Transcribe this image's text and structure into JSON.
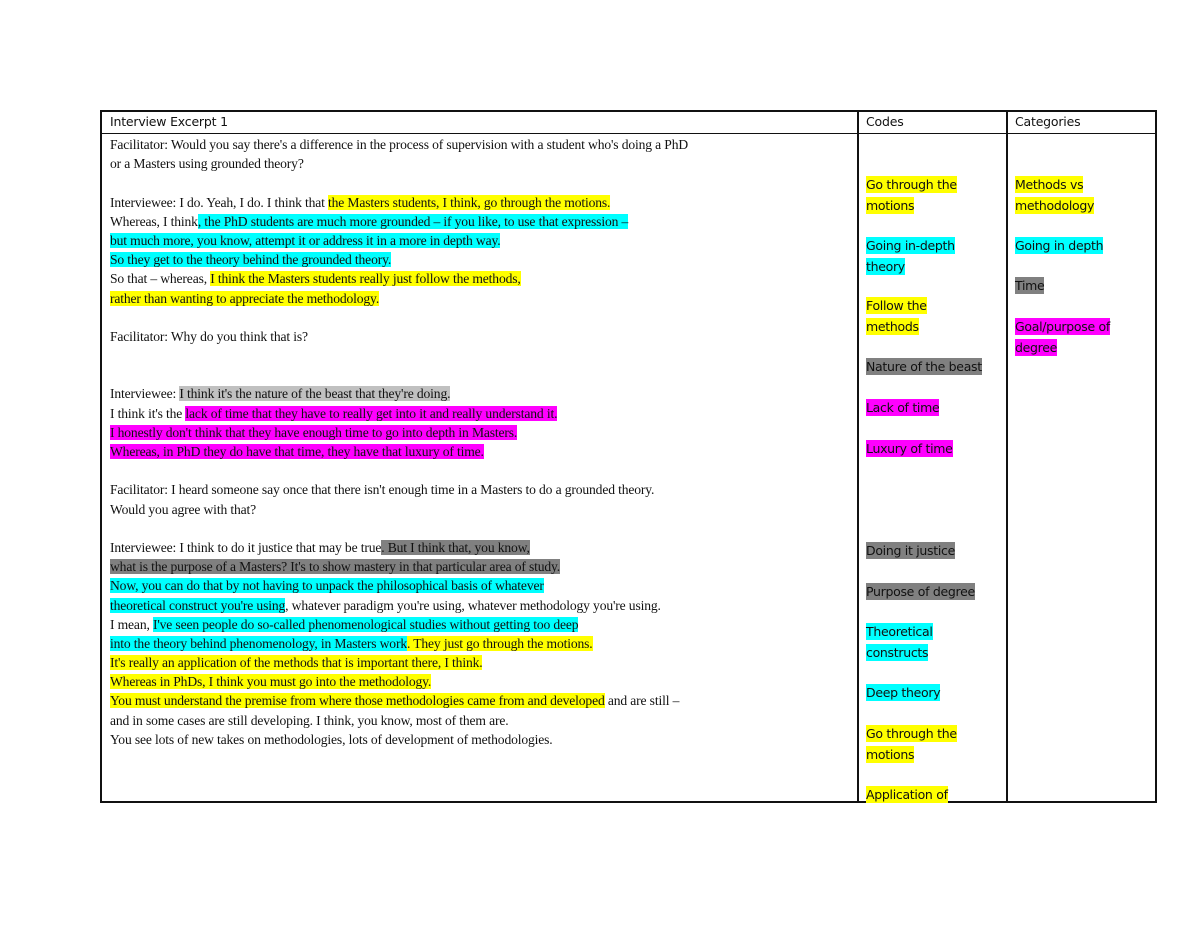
{
  "table": {
    "headers": [
      "Interview Excerpt 1",
      "Codes",
      "Categories"
    ],
    "highlight_colors": {
      "yellow": "#ffff00",
      "cyan": "#00ffff",
      "magenta": "#ff00ff",
      "light_gray": "#c0c0c0",
      "dark_gray": "#808080"
    },
    "excerpt": {
      "l1": "Facilitator: Would you say there's a difference in the process of supervision with a student who's doing a PhD",
      "l2": "or a Masters using grounded theory?",
      "l3a": "Interviewee: I do. Yeah, I do. I think that ",
      "l3b": "the Masters students, I think, go through the motions.",
      "l4a": " Whereas, I think",
      "l4b": ", the PhD students are much more grounded – if you like, to use that expression –",
      "l5": "but much more, you know, attempt it or address it in a more in depth way. ",
      "l6": "So they get to the theory behind the grounded theory.",
      "l7a": "So that – whereas, ",
      "l7b": "I think the Masters students really just follow the methods,",
      "l8": "rather than wanting to appreciate the methodology.",
      "l9": "Facilitator: Why do you think that is?",
      "l10a": "Interviewee: ",
      "l10b": "I think it's the nature of the beast that they're doing.",
      "l11a": "I think it's the ",
      "l11b": "lack of time that they have to really get into it and really understand it.",
      "l12": "I honestly don't think that they have enough time to go into depth in Masters.",
      "l13": "Whereas, in PhD they do have that time, they have that luxury of time.",
      "l14": "Facilitator: I heard someone say once that there isn't enough time in a Masters to do a grounded theory.",
      "l15": "Would you agree with that?",
      "l16a": "Interviewee: I think to do it justice that may be true",
      "l16b": ". But I think that, you know,",
      "l17": "what is the purpose of a Masters? It's to show mastery in that particular area of study.",
      "l18": "Now, you can do that by not having to unpack the philosophical basis of whatever",
      "l19a": "theoretical construct you're using",
      "l19b": ", whatever paradigm you're using, whatever methodology you're using.",
      "l20a": "I mean, ",
      "l20b": "I've seen people do so-called phenomenological studies without getting too deep",
      "l21a": "into the theory behind phenomenology, in Masters work",
      "l21b": ". They just go through the motions.",
      "l22": " It's really an application of the methods that is important there, I think.",
      "l23": "Whereas in PhDs, I think you must go into the methodology. ",
      "l24a": "You must understand the premise from where those methodologies came from and developed",
      "l24b": " and are still –",
      "l25": " and in some cases are still developing. I think, you know, most of them are.",
      "l26": "You see lots of new takes on methodologies, lots of development of methodologies."
    },
    "codes": [
      {
        "l1": "Go through the",
        "l2": "motions",
        "color": "yellow"
      },
      {
        "l1": "Going in-depth",
        "l2": "theory",
        "color": "cyan"
      },
      {
        "l1": "Follow the",
        "l2": "methods",
        "color": "yellow"
      },
      {
        "l1": "Nature of the beast",
        "color": "dark_gray"
      },
      {
        "l1": "Lack of time",
        "color": "magenta"
      },
      {
        "l1": "Luxury of time",
        "color": "magenta"
      },
      {
        "l1": "Doing it justice",
        "color": "dark_gray"
      },
      {
        "l1": "Purpose of degree",
        "color": "dark_gray"
      },
      {
        "l1": "Theoretical",
        "l2": "constructs",
        "color": "cyan"
      },
      {
        "l1": "Deep theory",
        "color": "cyan"
      },
      {
        "l1": "Go through the",
        "l2": "motions",
        "color": "yellow"
      },
      {
        "l1": "Application of",
        "color": "yellow"
      }
    ],
    "categories": [
      {
        "l1": "Methods vs",
        "l2": "methodology",
        "color": "yellow"
      },
      {
        "l1": "Going in depth",
        "color": "cyan"
      },
      {
        "l1": "Time",
        "color": "dark_gray"
      },
      {
        "l1": "Goal/purpose of",
        "l2": "degree",
        "color": "magenta"
      }
    ]
  }
}
